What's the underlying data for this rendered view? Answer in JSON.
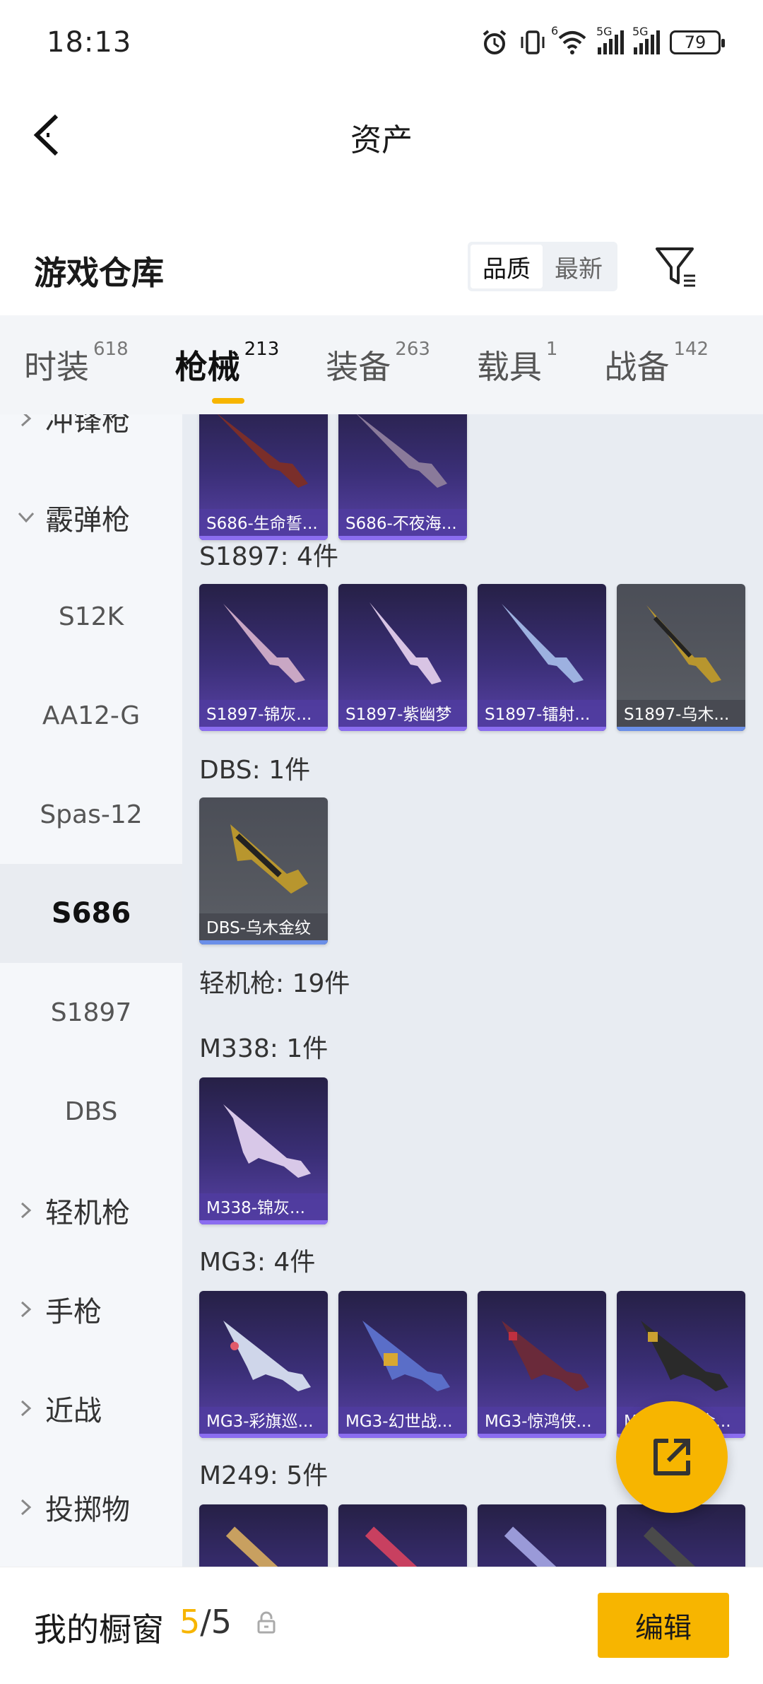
{
  "status_bar": {
    "time": "18:13",
    "battery": "79",
    "signal_tags": [
      "5G",
      "5G"
    ],
    "wifi_tag": "6"
  },
  "nav": {
    "title": "资产"
  },
  "warehouse": {
    "title": "游戏仓库",
    "sort_options": [
      "品质",
      "最新"
    ],
    "sort_selected": "品质"
  },
  "tabs": [
    {
      "label": "时装",
      "count": "618"
    },
    {
      "label": "枪械",
      "count": "213",
      "active": true
    },
    {
      "label": "装备",
      "count": "263"
    },
    {
      "label": "载具",
      "count": "1"
    },
    {
      "label": "战备",
      "count": "142"
    }
  ],
  "sidebar": {
    "items": [
      {
        "label": "冲锋枪",
        "type": "group",
        "expanded": false
      },
      {
        "label": "霰弹枪",
        "type": "group",
        "expanded": true
      },
      {
        "label": "S12K",
        "type": "sub"
      },
      {
        "label": "AA12-G",
        "type": "sub"
      },
      {
        "label": "Spas-12",
        "type": "sub"
      },
      {
        "label": "S686",
        "type": "sub",
        "active": true
      },
      {
        "label": "S1897",
        "type": "sub"
      },
      {
        "label": "DBS",
        "type": "sub"
      },
      {
        "label": "轻机枪",
        "type": "group",
        "expanded": false
      },
      {
        "label": "手枪",
        "type": "group",
        "expanded": false
      },
      {
        "label": "近战",
        "type": "group",
        "expanded": false
      },
      {
        "label": "投掷物",
        "type": "group",
        "expanded": false
      }
    ]
  },
  "content": {
    "s686_cards": [
      "S686-生命誓...",
      "S686-不夜海..."
    ],
    "s1897": {
      "title": "S1897: 4件",
      "cards": [
        "S1897-锦灰...",
        "S1897-紫幽梦",
        "S1897-镭射...",
        "S1897-乌木..."
      ]
    },
    "dbs": {
      "title": "DBS: 1件",
      "cards": [
        "DBS-乌木金纹"
      ]
    },
    "lmg_title": "轻机枪: 19件",
    "m338": {
      "title": "M338: 1件",
      "cards": [
        "M338-锦灰..."
      ]
    },
    "mg3": {
      "title": "MG3: 4件",
      "cards": [
        "MG3-彩旗巡...",
        "MG3-幻世战...",
        "MG3-惊鸿侠...",
        "MG3-乌木金..."
      ]
    },
    "m249": {
      "title": "M249: 5件"
    }
  },
  "bottom": {
    "showcase_label": "我的橱窗",
    "current": "5",
    "separator": "/",
    "total": "5",
    "edit_label": "编辑"
  },
  "colors": {
    "accent": "#f7b500",
    "card_purple": "#3b2f78",
    "card_gold": "#55585f"
  }
}
